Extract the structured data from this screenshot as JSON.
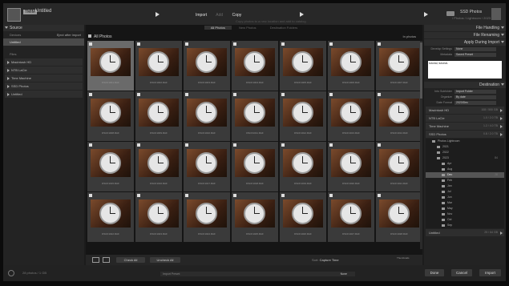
{
  "topbar": {
    "source_badge": "TMIM",
    "source_name": "Untitled",
    "modes": [
      "Import",
      "Add",
      "Copy"
    ],
    "mode_label": "Copy",
    "mode_sub": "Copy photos to a new location and add to catalog",
    "destination_name": "SSD Photos",
    "destination_sub": "/ Photos / Lightroom / 2023"
  },
  "left": {
    "source_header": "Source",
    "devices_label": "Devices",
    "eject_label": "Eject after import",
    "untitled": "Untitled",
    "files_label": "Files",
    "volumes": [
      "Macintosh HD",
      "NTB LaCie",
      "Time Machine",
      "SSD Photos",
      "Untitled"
    ]
  },
  "center": {
    "tabs": [
      "All Photos",
      "New Photos",
      "Destination Folders"
    ],
    "grid_title": "All Photos",
    "sort_menu": "In photos",
    "photos": [
      "DSCF1001.RAF",
      "DSCF1002.RAF",
      "DSCF1003.RAF",
      "DSCF1004.RAF",
      "DSCF1005.RAF",
      "DSCF1006.RAF",
      "DSCF1007.RAF",
      "DSCF1008.RAF",
      "DSCF1009.RAF",
      "DSCF1010.RAF",
      "DSCF1011.RAF",
      "DSCF1012.RAF",
      "DSCF1013.RAF",
      "DSCF1014.RAF",
      "DSCF1015.RAF",
      "DSCF1016.RAF",
      "DSCF1017.RAF",
      "DSCF1018.RAF",
      "DSCF1019.RAF",
      "DSCF1020.RAF",
      "DSCF1021.RAF",
      "DSCF1022.RAF",
      "DSCF1023.RAF",
      "DSCF1024.RAF",
      "DSCF1025.RAF",
      "DSCF1026.RAF",
      "DSCF1027.RAF",
      "DSCF1028.RAF"
    ],
    "check_all": "Check All",
    "uncheck_all": "Uncheck All",
    "sort_label": "Sort:",
    "sort_value": "Capture Time",
    "thumbnails_label": "Thumbnails"
  },
  "right": {
    "file_handling": "File Handling",
    "file_renaming": "File Renaming",
    "apply_during_import": "Apply During Import",
    "develop_settings_label": "Develop Settings",
    "develop_settings_value": "None",
    "metadata_label": "Metadata",
    "metadata_value": "Saved Preset",
    "keywords": "tutorial, tutorial-",
    "destination": "Destination",
    "into_subfolder_label": "Into Subfolder",
    "into_subfolder_value": "Import Folder",
    "organize_label": "Organize",
    "organize_value": "By date",
    "date_format_label": "Date Format",
    "date_format_value": "2023/Dec",
    "volumes": [
      {
        "name": "Macintosh HD",
        "size": "108 / 500 GB"
      },
      {
        "name": "NTB LaCie",
        "size": "1.0 / 2.0 TB"
      },
      {
        "name": "Time Machine",
        "size": "1.2 / 4.0 TB"
      },
      {
        "name": "SSD Photos",
        "size": "0.8 / 2.0 TB"
      }
    ],
    "tree_root": "Photos Lightroom",
    "tree_items": [
      {
        "name": "2021",
        "count": ""
      },
      {
        "name": "2022",
        "count": ""
      },
      {
        "name": "2023",
        "count": "84"
      },
      {
        "name": "Apr",
        "count": ""
      },
      {
        "name": "Aug",
        "count": ""
      },
      {
        "name": "Dec",
        "count": "28"
      },
      {
        "name": "Feb",
        "count": ""
      },
      {
        "name": "Jan",
        "count": ""
      },
      {
        "name": "Jul",
        "count": ""
      },
      {
        "name": "Jun",
        "count": ""
      },
      {
        "name": "Mar",
        "count": ""
      },
      {
        "name": "May",
        "count": ""
      },
      {
        "name": "Nov",
        "count": ""
      },
      {
        "name": "Oct",
        "count": ""
      },
      {
        "name": "Sep",
        "count": ""
      }
    ],
    "untitled_vol": {
      "name": "Untitled",
      "size": "25 / 64 GB"
    }
  },
  "bottom": {
    "left_text": "28 photos / 1 GB",
    "preset_label": "Import Preset:",
    "preset_value": "None",
    "done": "Done",
    "cancel": "Cancel",
    "import": "Import"
  }
}
